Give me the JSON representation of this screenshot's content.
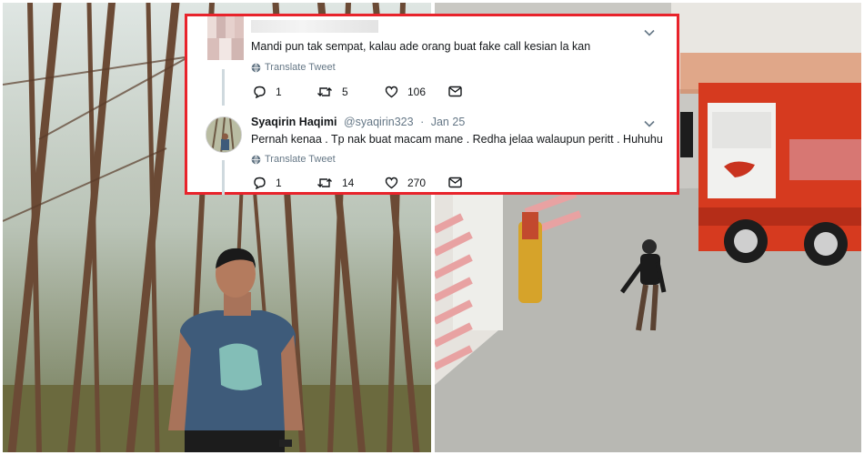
{
  "tweet_thread": {
    "reply_tweet": {
      "text": "Mandi pun tak sempat, kalau ade orang buat fake call kesian la kan",
      "translate_label": "Translate Tweet",
      "stats": {
        "replies": "1",
        "retweets": "5",
        "likes": "106"
      }
    },
    "main_tweet": {
      "author_name": "Syaqirin Haqimi",
      "author_handle": "@syaqirin323",
      "separator": "·",
      "date": "Jan 25",
      "text": "Pernah kenaa . Tp nak buat macam mane . Redha jelaa walaupun peritt . Huhuhu",
      "translate_label": "Translate Tweet",
      "stats": {
        "replies": "1",
        "retweets": "14",
        "likes": "270"
      }
    }
  },
  "colors": {
    "frame_border": "#e8232b",
    "tweet_text": "#14171a",
    "secondary_text": "#657786",
    "thread_line": "#cfd9de"
  },
  "icons": [
    "chevron-down-icon",
    "globe-icon",
    "reply-icon",
    "retweet-icon",
    "like-icon",
    "message-icon"
  ]
}
